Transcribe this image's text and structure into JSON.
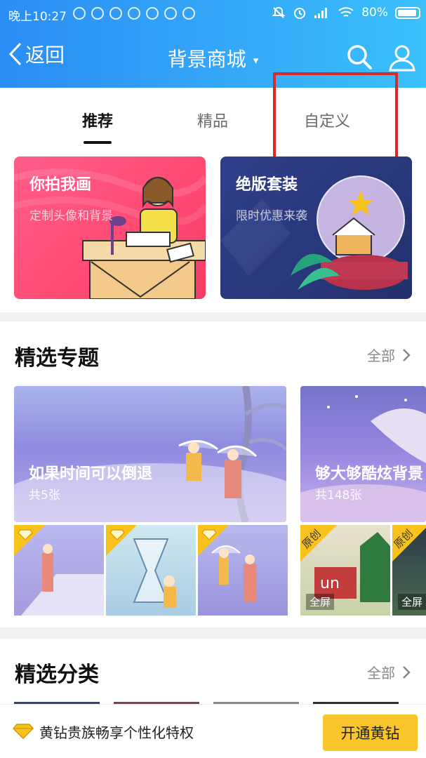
{
  "status_bar": {
    "time": "晚上10:27",
    "battery": "80%"
  },
  "nav": {
    "back_label": "返回",
    "title": "背景商城",
    "caret": "▾"
  },
  "tabs": [
    {
      "label": "推荐",
      "active": true
    },
    {
      "label": "精品",
      "active": false
    },
    {
      "label": "自定义",
      "active": false
    }
  ],
  "promos": [
    {
      "title": "你拍我画",
      "subtitle": "定制头像和背景"
    },
    {
      "title": "绝版套装",
      "subtitle": "限时优惠来袭"
    }
  ],
  "featured_topics": {
    "title": "精选专题",
    "more_label": "全部",
    "items": [
      {
        "name": "如果时间可以倒退",
        "count": "共5张"
      },
      {
        "name": "够大够酷炫背景",
        "count": "共148张"
      }
    ],
    "thumbnail_badges": {
      "original_label": "原创",
      "fullscreen_label": "全屏"
    }
  },
  "featured_categories": {
    "title": "精选分类",
    "more_label": "全部"
  },
  "bottom_bar": {
    "vip_text": "黄钻贵族畅享个性化特权",
    "open_button": "开通黄钻"
  },
  "colors": {
    "header_start": "#2a8df5",
    "header_end": "#3ac0fb",
    "highlight_box": "#d82a2a",
    "vip_yellow": "#f8c62a",
    "promo_pink": "#ff4a73",
    "promo_navy": "#28377a"
  }
}
